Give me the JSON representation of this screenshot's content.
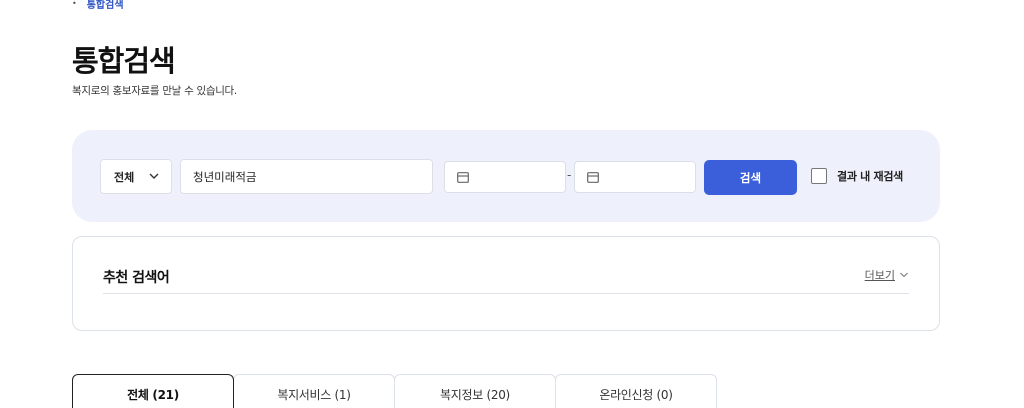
{
  "breadcrumb": {
    "current": "통합검색"
  },
  "page": {
    "title": "통합검색",
    "description": "복지로의 홍보자료를 만날 수 있습니다."
  },
  "search": {
    "scope_selected": "전체",
    "keyword_value": "청년미래적금",
    "date_from_value": "",
    "date_to_value": "",
    "date_separator": "-",
    "button_label": "검색",
    "recheck_label": "결과 내 재검색",
    "recheck_checked": false
  },
  "recommend": {
    "title": "추천 검색어",
    "more_label": "더보기"
  },
  "tabs": [
    {
      "label": "전체 (21)",
      "active": true
    },
    {
      "label": "복지서비스 (1)",
      "active": false
    },
    {
      "label": "복지정보 (20)",
      "active": false
    },
    {
      "label": "온라인신청 (0)",
      "active": false
    }
  ],
  "colors": {
    "accent": "#3b5fdb",
    "search_panel_bg": "#eef1fb",
    "breadcrumb_text": "#2f55c7"
  },
  "icons": [
    "chevron-down-icon",
    "calendar-icon",
    "checkbox-icon"
  ]
}
